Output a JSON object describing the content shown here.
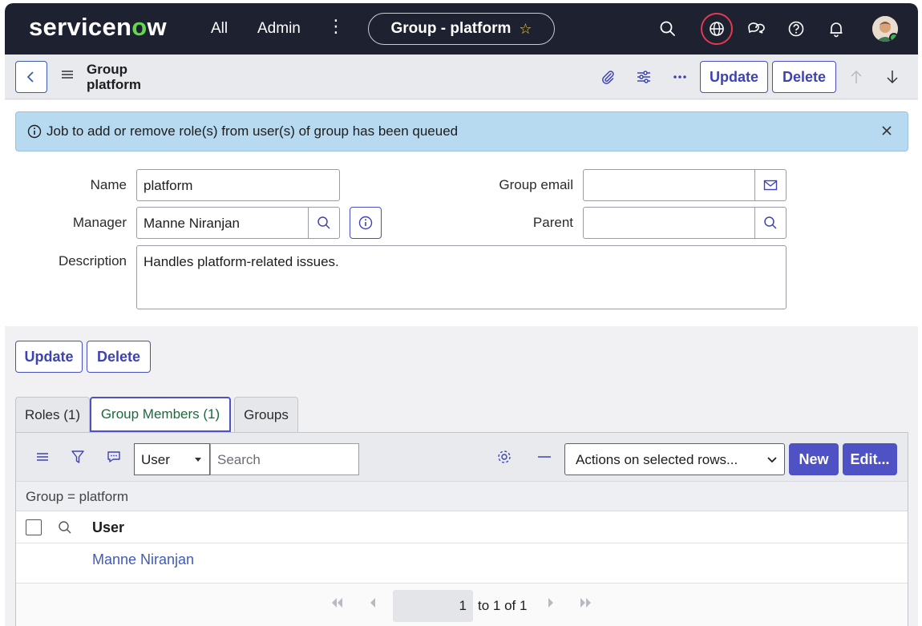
{
  "nav": {
    "logo_text_a": "servicen",
    "logo_text_o": "o",
    "logo_text_b": "w",
    "all": "All",
    "admin": "Admin",
    "more": "⋮",
    "context_pill": "Group - platform",
    "star": "☆"
  },
  "header": {
    "title_line1": "Group",
    "title_line2": "platform",
    "update": "Update",
    "delete": "Delete"
  },
  "banner": {
    "message": "Job to add or remove role(s) from user(s) of group has been queued"
  },
  "form": {
    "name_label": "Name",
    "name_value": "platform",
    "manager_label": "Manager",
    "manager_value": "Manne Niranjan",
    "description_label": "Description",
    "description_value": "Handles platform-related issues.",
    "group_email_label": "Group email",
    "group_email_value": "",
    "parent_label": "Parent",
    "parent_value": ""
  },
  "bottom_buttons": {
    "update": "Update",
    "delete": "Delete"
  },
  "tabs": [
    {
      "label": "Roles (1)"
    },
    {
      "label": "Group Members (1)",
      "active": true
    },
    {
      "label": "Groups"
    }
  ],
  "list": {
    "field_select": "User",
    "search_placeholder": "Search",
    "actions_select": "Actions on selected rows...",
    "new_button": "New",
    "edit_button": "Edit...",
    "breadcrumb": "Group = platform",
    "column_header": "User",
    "rows": [
      {
        "user": "Manne Niranjan"
      }
    ],
    "pager_page": "1",
    "pager_text": "to 1 of 1"
  },
  "colors": {
    "nav_bg": "#1e2130",
    "accent": "#4e52c5",
    "logo_green": "#62d84e",
    "banner_bg": "#b8daf0",
    "link": "#3e5bc1",
    "globe_ring": "#e53950"
  }
}
